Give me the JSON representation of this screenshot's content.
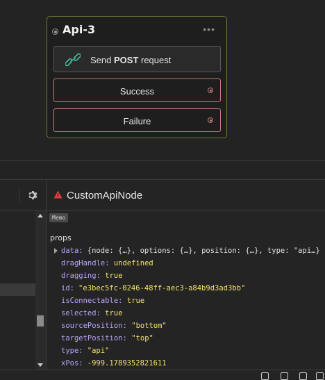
{
  "node": {
    "title": "Api-3",
    "menu_icon": "ellipsis-icon",
    "action_prefix": "Send ",
    "action_method": "POST",
    "action_suffix": " request",
    "outlets": [
      "Success",
      "Failure"
    ],
    "border_color": "#6f7a34",
    "outlet_color": "#c47b7b"
  },
  "devtools": {
    "component_name": "CustomApiNode",
    "memo_label": "Memo",
    "props_title": "props",
    "props": [
      {
        "key": "data",
        "value": "{node: {…}, options: {…}, position: {…}, type: \"api…}",
        "kind": "obj",
        "expandable": true
      },
      {
        "key": "dragHandle",
        "value": "undefined",
        "kind": "undef"
      },
      {
        "key": "dragging",
        "value": "true",
        "kind": "bool"
      },
      {
        "key": "id",
        "value": "\"e3bec5fc-0246-48ff-aec3-a84b9d3ad3bb\"",
        "kind": "str"
      },
      {
        "key": "isConnectable",
        "value": "true",
        "kind": "bool"
      },
      {
        "key": "selected",
        "value": "true",
        "kind": "bool"
      },
      {
        "key": "sourcePosition",
        "value": "\"bottom\"",
        "kind": "str"
      },
      {
        "key": "targetPosition",
        "value": "\"top\"",
        "kind": "str"
      },
      {
        "key": "type",
        "value": "\"api\"",
        "kind": "str"
      },
      {
        "key": "xPos",
        "value": "-999.1789352821611",
        "kind": "num"
      }
    ]
  }
}
